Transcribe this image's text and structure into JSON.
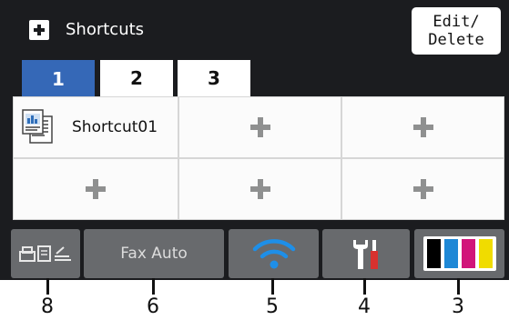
{
  "header": {
    "title": "Shortcuts",
    "edit_line1": "Edit/",
    "edit_line2": "Delete"
  },
  "tabs": [
    {
      "label": "1",
      "active": true
    },
    {
      "label": "2",
      "active": false
    },
    {
      "label": "3",
      "active": false
    }
  ],
  "shortcuts": [
    {
      "label": "Shortcut01",
      "icon": "copy-document-icon"
    },
    {
      "label": "",
      "icon": "add-plus-icon"
    },
    {
      "label": "",
      "icon": "add-plus-icon"
    },
    {
      "label": "",
      "icon": "add-plus-icon"
    },
    {
      "label": "",
      "icon": "add-plus-icon"
    },
    {
      "label": "",
      "icon": "add-plus-icon"
    }
  ],
  "bottom_bar": {
    "mode_icon": "fax-copy-scan-mode-icon",
    "fax_label": "Fax Auto",
    "wifi_icon": "wifi-icon",
    "settings_icon": "settings-wrench-icon",
    "toner_icon": "toner-icon",
    "toner_colors": [
      "#000000",
      "#1e88d6",
      "#d1147a",
      "#f0dc00"
    ]
  },
  "callouts": [
    "8",
    "6",
    "5",
    "4",
    "3"
  ],
  "colors": {
    "screen_bg": "#1b1c1f",
    "tab_active": "#3568b7",
    "button_gray": "#686a6d"
  }
}
